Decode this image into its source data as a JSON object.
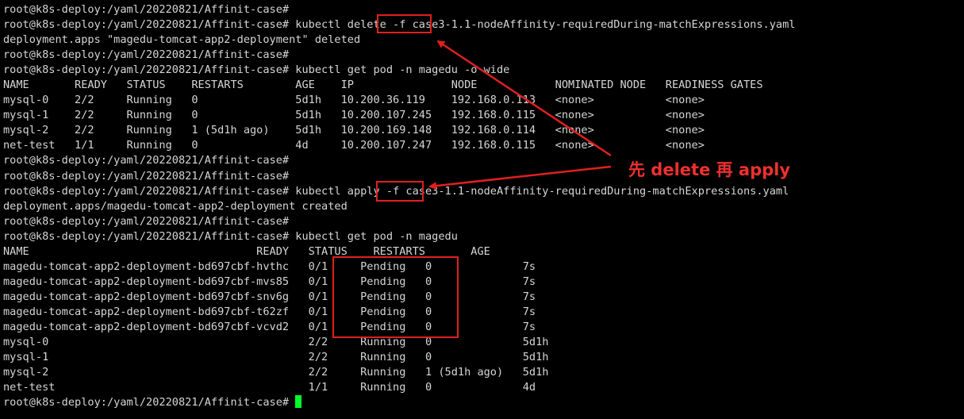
{
  "terminal": {
    "lines": [
      "root@k8s-deploy:/yaml/20220821/Affinit-case#",
      "root@k8s-deploy:/yaml/20220821/Affinit-case# kubectl delete -f case3-1.1-nodeAffinity-requiredDuring-matchExpressions.yaml",
      "deployment.apps \"magedu-tomcat-app2-deployment\" deleted",
      "root@k8s-deploy:/yaml/20220821/Affinit-case#",
      "root@k8s-deploy:/yaml/20220821/Affinit-case# kubectl get pod -n magedu -o wide",
      "NAME       READY   STATUS    RESTARTS        AGE    IP               NODE            NOMINATED NODE   READINESS GATES",
      "mysql-0    2/2     Running   0               5d1h   10.200.36.119    192.168.0.113   <none>           <none>",
      "mysql-1    2/2     Running   0               5d1h   10.200.107.245   192.168.0.115   <none>           <none>",
      "mysql-2    2/2     Running   1 (5d1h ago)    5d1h   10.200.169.148   192.168.0.114   <none>           <none>",
      "net-test   1/1     Running   0               4d     10.200.107.247   192.168.0.115   <none>           <none>",
      "root@k8s-deploy:/yaml/20220821/Affinit-case#",
      "root@k8s-deploy:/yaml/20220821/Affinit-case#",
      "root@k8s-deploy:/yaml/20220821/Affinit-case# kubectl apply -f case3-1.1-nodeAffinity-requiredDuring-matchExpressions.yaml",
      "deployment.apps/magedu-tomcat-app2-deployment created",
      "root@k8s-deploy:/yaml/20220821/Affinit-case#",
      "root@k8s-deploy:/yaml/20220821/Affinit-case# kubectl get pod -n magedu",
      "NAME                                   READY   STATUS    RESTARTS       AGE",
      "magedu-tomcat-app2-deployment-bd697cbf-hvthc   0/1     Pending   0              7s",
      "magedu-tomcat-app2-deployment-bd697cbf-mvs85   0/1     Pending   0              7s",
      "magedu-tomcat-app2-deployment-bd697cbf-snv6g   0/1     Pending   0              7s",
      "magedu-tomcat-app2-deployment-bd697cbf-t62zf   0/1     Pending   0              7s",
      "magedu-tomcat-app2-deployment-bd697cbf-vcvd2   0/1     Pending   0              7s",
      "mysql-0                                        2/2     Running   0              5d1h",
      "mysql-1                                        2/2     Running   0              5d1h",
      "mysql-2                                        2/2     Running   1 (5d1h ago)   5d1h",
      "net-test                                       1/1     Running   0              4d"
    ],
    "prompt": "root@k8s-deploy:/yaml/20220821/Affinit-case#"
  },
  "annotation": {
    "text": "先 delete 再 apply",
    "color": "#f03030"
  },
  "colors": {
    "background": "#000000",
    "text": "#d6d6d6",
    "cursor": "#00ff2a",
    "highlight": "#e02020"
  }
}
